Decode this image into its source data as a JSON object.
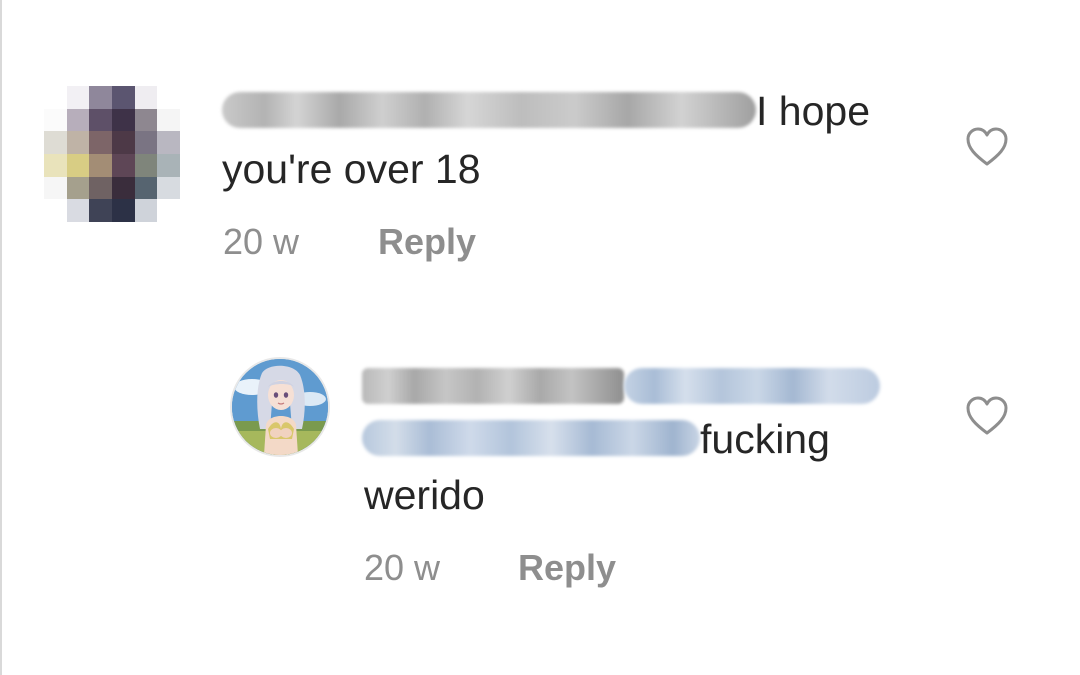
{
  "comments": [
    {
      "text_after_name": "I hope",
      "text_line2": "you're over 18",
      "age": "20 w",
      "reply_label": "Reply",
      "avatar": "pixelated-avatar",
      "like_icon": "heart-outline-icon"
    },
    {
      "text_after_mentions": "fucking",
      "text_line3": "werido",
      "age": "20 w",
      "reply_label": "Reply",
      "avatar": "anime-character-avatar",
      "like_icon": "heart-outline-icon"
    }
  ],
  "colors": {
    "text": "#262626",
    "meta": "#8e8e8e",
    "redaction_gray": "#c8c8c8",
    "redaction_blue": "#b8c9de"
  }
}
